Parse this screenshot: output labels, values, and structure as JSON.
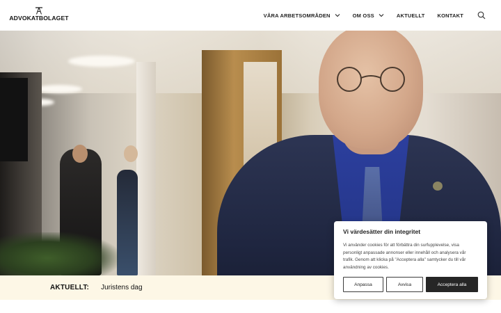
{
  "brand": {
    "name": "ADVOKATBOLAGET"
  },
  "nav": {
    "items": [
      {
        "label": "VÅRA ARBETSOMRÅDEN",
        "has_dropdown": true
      },
      {
        "label": "OM OSS",
        "has_dropdown": true
      },
      {
        "label": "AKTUELLT",
        "has_dropdown": false
      },
      {
        "label": "KONTAKT",
        "has_dropdown": false
      }
    ],
    "search_icon": "search-icon"
  },
  "news": {
    "label": "AKTUELLT:",
    "headline": "Juristens dag"
  },
  "cookie": {
    "title": "Vi värdesätter din integritet",
    "text": "Vi använder cookies för att förbättra din surfupplevelse, visa personligt anpassade annonser eller innehåll och analysera vår trafik. Genom att klicka på \"Acceptera alla\" samtycker du till vår användning av cookies.",
    "buttons": {
      "customize": "Anpassa",
      "reject": "Avvisa",
      "accept": "Acceptera alla"
    }
  },
  "colors": {
    "newsbar_bg": "#fdf7e6",
    "accept_bg": "#262626",
    "text": "#111111"
  }
}
